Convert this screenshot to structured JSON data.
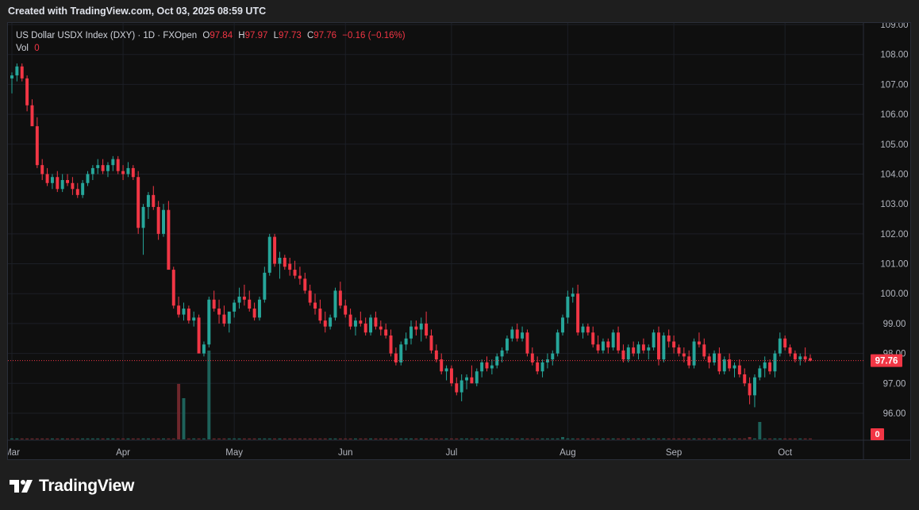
{
  "header": {
    "text": "Created with TradingView.com, Oct 03, 2025 08:59 UTC"
  },
  "legend": {
    "title": "US Dollar USDX Index (DXY) · 1D · FXOpen",
    "o_label": "O",
    "o_value": "97.84",
    "h_label": "H",
    "h_value": "97.97",
    "l_label": "L",
    "l_value": "97.73",
    "c_label": "C",
    "c_value": "97.76",
    "change": "−0.16 (−0.16%)",
    "vol_label": "Vol",
    "vol_value": "0"
  },
  "price_badge": "97.76",
  "volume_badge": "0",
  "footer": {
    "brand": "TradingView",
    "logo_icon": "tradingview-logo-icon"
  },
  "colors": {
    "up": "#26a69a",
    "down": "#f23645",
    "background": "#0f0f0f",
    "grid": "#1c1f26"
  },
  "chart_data": {
    "type": "candlestick",
    "title": "US Dollar USDX Index (DXY)",
    "interval": "1D",
    "source": "FXOpen",
    "ylim": [
      95.4,
      109.1
    ],
    "y_ticks": [
      "109.00",
      "108.00",
      "107.00",
      "106.00",
      "105.00",
      "104.00",
      "103.00",
      "102.00",
      "101.00",
      "100.00",
      "99.00",
      "98.00",
      "97.00",
      "96.00"
    ],
    "x_ticks": [
      {
        "label": "Mar",
        "index": 0
      },
      {
        "label": "Apr",
        "index": 22
      },
      {
        "label": "May",
        "index": 44
      },
      {
        "label": "Jun",
        "index": 66
      },
      {
        "label": "Jul",
        "index": 87
      },
      {
        "label": "Aug",
        "index": 110
      },
      {
        "label": "Sep",
        "index": 131
      },
      {
        "label": "Oct",
        "index": 153
      }
    ],
    "last_price": 97.76,
    "ohlc": [
      [
        107.2,
        107.4,
        106.7,
        107.3
      ],
      [
        107.3,
        107.7,
        107.1,
        107.6
      ],
      [
        107.6,
        107.7,
        107.1,
        107.2
      ],
      [
        107.2,
        107.3,
        106.1,
        106.3
      ],
      [
        106.3,
        106.5,
        105.8,
        105.6
      ],
      [
        105.6,
        105.9,
        104.2,
        104.3
      ],
      [
        104.3,
        104.5,
        103.8,
        104.0
      ],
      [
        104.0,
        104.2,
        103.6,
        103.7
      ],
      [
        103.7,
        104.0,
        103.5,
        103.9
      ],
      [
        103.9,
        104.1,
        103.4,
        103.5
      ],
      [
        103.5,
        104.0,
        103.4,
        103.8
      ],
      [
        103.8,
        104.0,
        103.6,
        103.7
      ],
      [
        103.7,
        103.9,
        103.3,
        103.5
      ],
      [
        103.5,
        103.7,
        103.2,
        103.3
      ],
      [
        103.3,
        103.8,
        103.2,
        103.7
      ],
      [
        103.7,
        104.1,
        103.6,
        104.0
      ],
      [
        104.0,
        104.3,
        103.8,
        104.2
      ],
      [
        104.2,
        104.5,
        104.0,
        104.3
      ],
      [
        104.3,
        104.5,
        104.0,
        104.1
      ],
      [
        104.1,
        104.4,
        103.9,
        104.3
      ],
      [
        104.3,
        104.6,
        104.1,
        104.5
      ],
      [
        104.5,
        104.6,
        104.0,
        104.1
      ],
      [
        104.1,
        104.3,
        103.8,
        104.0
      ],
      [
        104.0,
        104.4,
        103.9,
        104.2
      ],
      [
        104.2,
        104.3,
        103.8,
        103.9
      ],
      [
        103.9,
        104.1,
        102.0,
        102.2
      ],
      [
        102.2,
        103.0,
        101.3,
        102.9
      ],
      [
        102.9,
        103.4,
        102.5,
        103.3
      ],
      [
        103.3,
        103.6,
        102.8,
        102.9
      ],
      [
        102.9,
        103.1,
        101.8,
        102.0
      ],
      [
        102.0,
        103.0,
        101.9,
        102.8
      ],
      [
        102.8,
        103.1,
        100.9,
        100.8
      ],
      [
        100.8,
        100.9,
        99.5,
        99.6
      ],
      [
        99.6,
        99.9,
        99.2,
        99.3
      ],
      [
        99.3,
        99.7,
        99.1,
        99.5
      ],
      [
        99.5,
        99.6,
        99.0,
        99.1
      ],
      [
        99.1,
        99.4,
        98.9,
        99.2
      ],
      [
        99.2,
        99.3,
        98.7,
        98.0
      ],
      [
        98.0,
        98.4,
        97.9,
        98.3
      ],
      [
        98.3,
        99.9,
        98.2,
        99.8
      ],
      [
        99.8,
        100.1,
        99.4,
        99.5
      ],
      [
        99.5,
        99.8,
        99.0,
        99.3
      ],
      [
        99.3,
        99.6,
        98.9,
        99.0
      ],
      [
        99.0,
        99.3,
        98.7,
        99.4
      ],
      [
        99.4,
        99.8,
        99.2,
        99.7
      ],
      [
        99.7,
        100.2,
        99.5,
        99.9
      ],
      [
        99.9,
        100.3,
        99.6,
        99.8
      ],
      [
        99.8,
        100.1,
        99.4,
        99.5
      ],
      [
        99.5,
        99.7,
        99.1,
        99.2
      ],
      [
        99.2,
        99.9,
        99.1,
        99.8
      ],
      [
        99.8,
        100.9,
        99.7,
        100.7
      ],
      [
        100.7,
        102.0,
        100.6,
        101.9
      ],
      [
        101.9,
        102.0,
        100.9,
        101.0
      ],
      [
        101.0,
        101.4,
        100.5,
        101.2
      ],
      [
        101.2,
        101.3,
        100.8,
        100.9
      ],
      [
        101.0,
        101.2,
        100.6,
        100.8
      ],
      [
        100.8,
        101.1,
        100.5,
        100.6
      ],
      [
        100.6,
        100.9,
        100.3,
        100.5
      ],
      [
        100.5,
        100.7,
        100.0,
        100.1
      ],
      [
        100.1,
        100.3,
        99.6,
        99.7
      ],
      [
        99.7,
        100.0,
        99.3,
        99.5
      ],
      [
        99.5,
        99.8,
        99.0,
        99.1
      ],
      [
        99.1,
        99.4,
        98.7,
        98.9
      ],
      [
        98.9,
        99.3,
        98.8,
        99.2
      ],
      [
        99.2,
        100.2,
        99.1,
        100.1
      ],
      [
        100.1,
        100.4,
        99.5,
        99.6
      ],
      [
        99.6,
        99.8,
        99.2,
        99.3
      ],
      [
        99.3,
        99.5,
        98.8,
        98.9
      ],
      [
        98.9,
        99.2,
        98.6,
        99.1
      ],
      [
        99.1,
        99.4,
        98.9,
        99.0
      ],
      [
        99.0,
        99.2,
        98.6,
        98.7
      ],
      [
        98.7,
        99.3,
        98.6,
        99.2
      ],
      [
        99.2,
        99.4,
        98.8,
        98.9
      ],
      [
        98.9,
        99.1,
        98.6,
        98.8
      ],
      [
        98.8,
        99.0,
        98.5,
        98.6
      ],
      [
        98.6,
        98.8,
        97.9,
        98.0
      ],
      [
        98.0,
        98.2,
        97.6,
        97.7
      ],
      [
        97.7,
        98.4,
        97.6,
        98.3
      ],
      [
        98.3,
        98.7,
        98.1,
        98.5
      ],
      [
        98.5,
        99.1,
        98.3,
        98.9
      ],
      [
        98.9,
        99.1,
        98.6,
        98.8
      ],
      [
        98.8,
        99.2,
        98.4,
        99.0
      ],
      [
        99.0,
        99.4,
        98.5,
        98.6
      ],
      [
        98.6,
        98.8,
        98.0,
        98.1
      ],
      [
        98.1,
        98.3,
        97.7,
        97.8
      ],
      [
        97.8,
        98.0,
        97.3,
        97.4
      ],
      [
        97.4,
        97.6,
        97.1,
        97.5
      ],
      [
        97.5,
        97.6,
        96.9,
        97.0
      ],
      [
        97.0,
        97.2,
        96.6,
        96.7
      ],
      [
        96.7,
        97.3,
        96.4,
        97.1
      ],
      [
        97.1,
        97.3,
        96.8,
        97.2
      ],
      [
        97.2,
        97.6,
        97.0,
        97.0
      ],
      [
        97.0,
        97.5,
        96.9,
        97.4
      ],
      [
        97.4,
        97.8,
        97.2,
        97.7
      ],
      [
        97.7,
        97.9,
        97.4,
        97.5
      ],
      [
        97.5,
        97.8,
        97.3,
        97.6
      ],
      [
        97.6,
        98.0,
        97.5,
        97.9
      ],
      [
        97.9,
        98.2,
        97.7,
        98.1
      ],
      [
        98.1,
        98.6,
        98.0,
        98.5
      ],
      [
        98.5,
        98.9,
        98.4,
        98.8
      ],
      [
        98.8,
        99.0,
        98.4,
        98.5
      ],
      [
        98.5,
        98.9,
        98.4,
        98.7
      ],
      [
        98.7,
        98.8,
        97.9,
        98.0
      ],
      [
        98.0,
        98.2,
        97.6,
        97.7
      ],
      [
        97.7,
        97.9,
        97.3,
        97.4
      ],
      [
        97.4,
        97.8,
        97.2,
        97.7
      ],
      [
        97.7,
        98.0,
        97.5,
        97.8
      ],
      [
        97.8,
        98.1,
        97.6,
        98.0
      ],
      [
        98.0,
        98.8,
        97.9,
        98.7
      ],
      [
        98.7,
        99.3,
        98.6,
        99.2
      ],
      [
        99.2,
        100.1,
        99.0,
        99.9
      ],
      [
        99.9,
        100.2,
        99.7,
        100.0
      ],
      [
        100.0,
        100.3,
        98.6,
        98.7
      ],
      [
        98.7,
        99.0,
        98.5,
        98.9
      ],
      [
        98.9,
        99.0,
        98.6,
        98.7
      ],
      [
        98.7,
        98.9,
        98.2,
        98.3
      ],
      [
        98.3,
        98.6,
        98.0,
        98.1
      ],
      [
        98.1,
        98.5,
        98.0,
        98.4
      ],
      [
        98.4,
        98.5,
        98.0,
        98.2
      ],
      [
        98.2,
        98.8,
        98.1,
        98.7
      ],
      [
        98.7,
        98.9,
        98.0,
        98.1
      ],
      [
        98.1,
        98.3,
        97.7,
        97.8
      ],
      [
        97.8,
        98.3,
        97.7,
        98.2
      ],
      [
        98.2,
        98.4,
        97.9,
        98.0
      ],
      [
        98.0,
        98.4,
        97.8,
        98.3
      ],
      [
        98.3,
        98.5,
        98.0,
        98.1
      ],
      [
        98.1,
        98.3,
        97.8,
        98.2
      ],
      [
        98.2,
        98.8,
        98.1,
        98.7
      ],
      [
        98.7,
        98.9,
        97.6,
        97.8
      ],
      [
        97.8,
        98.7,
        97.7,
        98.6
      ],
      [
        98.6,
        98.8,
        98.2,
        98.4
      ],
      [
        98.4,
        98.6,
        98.0,
        98.2
      ],
      [
        98.2,
        98.3,
        97.9,
        98.0
      ],
      [
        98.0,
        98.2,
        97.7,
        97.9
      ],
      [
        97.9,
        98.1,
        97.5,
        97.6
      ],
      [
        97.6,
        98.5,
        97.5,
        98.4
      ],
      [
        98.4,
        98.7,
        98.2,
        98.3
      ],
      [
        98.3,
        98.5,
        97.8,
        97.9
      ],
      [
        97.9,
        98.0,
        97.5,
        97.7
      ],
      [
        97.7,
        98.1,
        97.6,
        98.0
      ],
      [
        98.0,
        98.2,
        97.3,
        97.4
      ],
      [
        97.4,
        97.9,
        97.3,
        97.8
      ],
      [
        97.8,
        98.0,
        97.4,
        97.5
      ],
      [
        97.5,
        97.7,
        97.2,
        97.6
      ],
      [
        97.6,
        97.8,
        97.2,
        97.3
      ],
      [
        97.3,
        97.5,
        96.9,
        97.0
      ],
      [
        97.0,
        97.2,
        96.3,
        96.6
      ],
      [
        96.6,
        97.3,
        96.2,
        97.2
      ],
      [
        97.2,
        97.6,
        97.1,
        97.5
      ],
      [
        97.5,
        97.9,
        97.2,
        97.7
      ],
      [
        97.7,
        97.8,
        97.3,
        97.4
      ],
      [
        97.4,
        98.1,
        97.2,
        98.0
      ],
      [
        98.0,
        98.7,
        97.9,
        98.5
      ],
      [
        98.5,
        98.6,
        98.1,
        98.2
      ],
      [
        98.2,
        98.3,
        97.9,
        98.0
      ],
      [
        98.0,
        98.1,
        97.7,
        97.8
      ],
      [
        97.8,
        98.0,
        97.6,
        97.9
      ],
      [
        97.9,
        98.2,
        97.7,
        97.8
      ],
      [
        97.84,
        97.97,
        97.73,
        97.76
      ]
    ],
    "volume_note": "daily volume bars, mostly near zero with spikes in late April/early May and late September",
    "volume": {
      "33": 70,
      "34": 52,
      "39": 112,
      "109": 3,
      "146": 3,
      "148": 22
    }
  }
}
